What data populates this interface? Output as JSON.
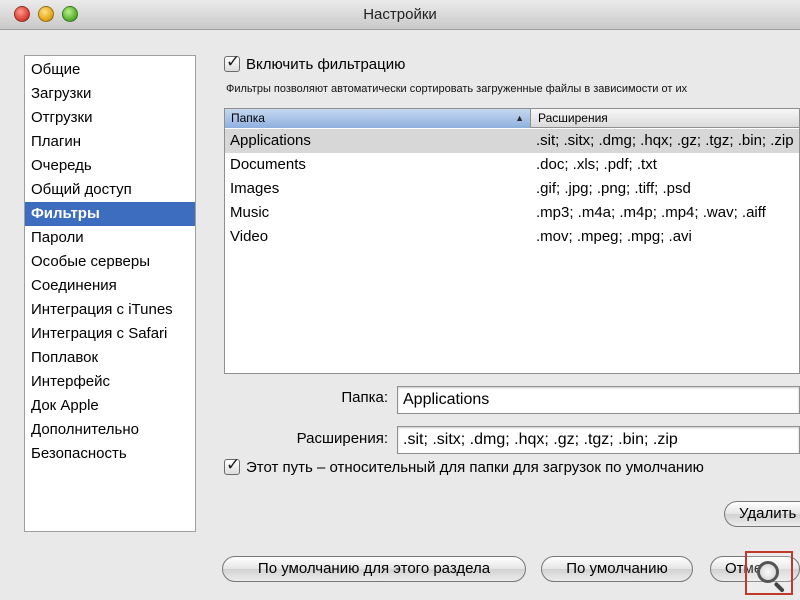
{
  "window": {
    "title": "Настройки"
  },
  "sidebar": {
    "items": [
      {
        "label": "Общие"
      },
      {
        "label": "Загрузки"
      },
      {
        "label": "Отгрузки"
      },
      {
        "label": "Плагин"
      },
      {
        "label": "Очередь"
      },
      {
        "label": "Общий доступ"
      },
      {
        "label": "Фильтры",
        "selected": true
      },
      {
        "label": "Пароли"
      },
      {
        "label": "Особые серверы"
      },
      {
        "label": "Соединения"
      },
      {
        "label": "Интеграция с iTunes"
      },
      {
        "label": "Интеграция с Safari"
      },
      {
        "label": "Поплавок"
      },
      {
        "label": "Интерфейс"
      },
      {
        "label": "Док Apple"
      },
      {
        "label": "Дополнительно"
      },
      {
        "label": "Безопасность"
      }
    ]
  },
  "filters": {
    "enable_label": "Включить фильтрацию",
    "enable_checked": true,
    "description": "Фильтры позволяют автоматически сортировать загруженные файлы в зависимости от их",
    "table": {
      "columns": [
        "Папка",
        "Расширения"
      ],
      "sort_arrow": "▲",
      "rows": [
        {
          "folder": "Applications",
          "extensions": ".sit; .sitx; .dmg; .hqx; .gz; .tgz; .bin; .zip",
          "selected": true
        },
        {
          "folder": "Documents",
          "extensions": ".doc; .xls; .pdf; .txt"
        },
        {
          "folder": "Images",
          "extensions": ".gif; .jpg; .png; .tiff; .psd"
        },
        {
          "folder": "Music",
          "extensions": ".mp3; .m4a; .m4p; .mp4; .wav; .aiff"
        },
        {
          "folder": "Video",
          "extensions": ".mov; .mpeg; .mpg; .avi"
        }
      ]
    },
    "folder_label": "Папка:",
    "folder_value": "Applications",
    "extensions_label": "Расширения:",
    "extensions_value": ".sit; .sitx; .dmg; .hqx; .gz; .tgz; .bin; .zip",
    "relative_label": "Этот путь – относительный для папки для загрузок по умолчанию",
    "relative_checked": true,
    "delete_button": "Удалить"
  },
  "footer": {
    "section_defaults_button": "По умолчанию для этого раздела",
    "defaults_button": "По умолчанию",
    "cancel_button": "Отмена"
  },
  "colors": {
    "selection": "#3d6dbf",
    "zoom_box": "#c0392b"
  },
  "icons": {
    "zoom": "magnifier-icon"
  }
}
